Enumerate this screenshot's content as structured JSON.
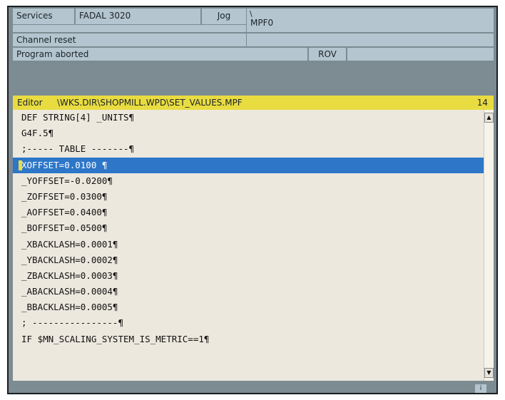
{
  "header": {
    "area": "Services",
    "machine": "FADAL 3020",
    "mode": "Jog",
    "program_tick": "\\",
    "program": "MPF0",
    "channel_status": "Channel reset",
    "program_status": "Program aborted",
    "rov": "ROV"
  },
  "editor": {
    "label": "Editor",
    "path": "\\WKS.DIR\\SHOPMILL.WPD\\SET_VALUES.MPF",
    "line_number": "14",
    "lines": [
      "DEF STRING[4] _UNITS¶",
      "G4F.5¶",
      ";----- TABLE -------¶",
      "XOFFSET=0.0100 ¶",
      "_YOFFSET=-0.0200¶",
      "_ZOFFSET=0.0300¶",
      "_AOFFSET=0.0400¶",
      "_BOFFSET=0.0500¶",
      "_XBACKLASH=0.0001¶",
      "_YBACKLASH=0.0002¶",
      "_ZBACKLASH=0.0003¶",
      "_ABACKLASH=0.0004¶",
      "_BBACKLASH=0.0005¶",
      "; ----------------¶",
      "IF $MN_SCALING_SYSTEM_IS_METRIC==1¶"
    ],
    "selected_index": 3
  },
  "scrollbar": {
    "up": "▲",
    "down": "▼"
  },
  "bottom": {
    "button": "i"
  },
  "colors": {
    "background": "#7d8b92",
    "header_cell": "#b4c5cf",
    "title_bar": "#e9dc41",
    "selection": "#2d76c8",
    "editor_bg": "#ece8dd"
  }
}
